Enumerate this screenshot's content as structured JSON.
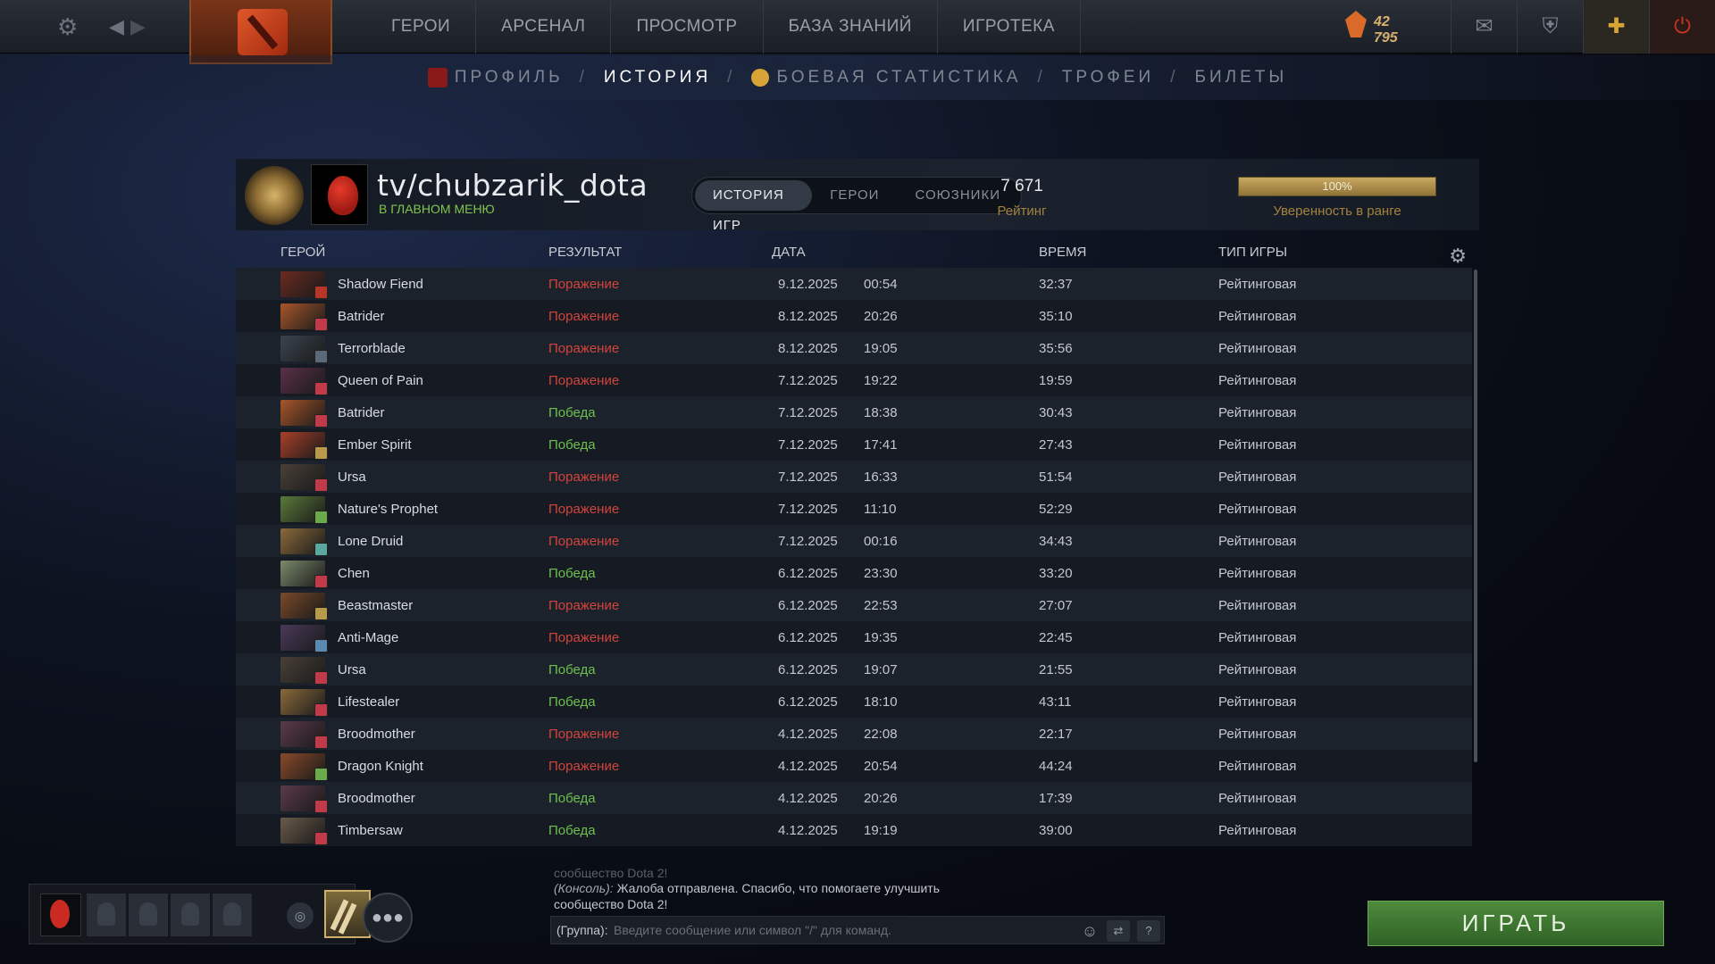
{
  "topbar": {
    "nav": [
      "ГЕРОИ",
      "АРСЕНАЛ",
      "ПРОСМОТР",
      "БАЗА ЗНАНИЙ",
      "ИГРОТЕКА"
    ],
    "currency_value": "42 795",
    "currency_sub": "○○○"
  },
  "subnav": {
    "profile": "ПРОФИЛЬ",
    "history": "ИСТОРИЯ",
    "stats": "БОЕВАЯ СТАТИСТИКА",
    "trophies": "ТРОФЕИ",
    "tickets": "БИЛЕТЫ",
    "sep": "/"
  },
  "profile": {
    "name": "tv/chubzarik_dota",
    "status": "В ГЛАВНОМ МЕНЮ",
    "tabs": [
      "ИСТОРИЯ ИГР",
      "ГЕРОИ",
      "СОЮЗНИКИ"
    ],
    "rating_value": "7 671",
    "rating_label": "Рейтинг",
    "confidence_value": "100%",
    "confidence_fraction": 1.0,
    "confidence_label": "Уверенность в ранге"
  },
  "table": {
    "headers": {
      "hero": "ГЕРОЙ",
      "result": "РЕЗУЛЬТАТ",
      "date": "ДАТА",
      "duration": "ВРЕМЯ",
      "type": "ТИП ИГРЫ"
    },
    "rows": [
      {
        "hero": "Shadow Fiend",
        "result": "Поражение",
        "win": false,
        "date": "9.12.2025",
        "time": "00:54",
        "duration": "32:37",
        "type": "Рейтинговая",
        "color": "#6b2a22",
        "badge": "#b8352a"
      },
      {
        "hero": "Batrider",
        "result": "Поражение",
        "win": false,
        "date": "8.12.2025",
        "time": "20:26",
        "duration": "35:10",
        "type": "Рейтинговая",
        "color": "#a8562a",
        "badge": "#c03a4a"
      },
      {
        "hero": "Terrorblade",
        "result": "Поражение",
        "win": false,
        "date": "8.12.2025",
        "time": "19:05",
        "duration": "35:56",
        "type": "Рейтинговая",
        "color": "#3a4450",
        "badge": "#5a6a78"
      },
      {
        "hero": "Queen of Pain",
        "result": "Поражение",
        "win": false,
        "date": "7.12.2025",
        "time": "19:22",
        "duration": "19:59",
        "type": "Рейтинговая",
        "color": "#5a3048",
        "badge": "#c03a4a"
      },
      {
        "hero": "Batrider",
        "result": "Победа",
        "win": true,
        "date": "7.12.2025",
        "time": "18:38",
        "duration": "30:43",
        "type": "Рейтинговая",
        "color": "#a8562a",
        "badge": "#c03a4a"
      },
      {
        "hero": "Ember Spirit",
        "result": "Победа",
        "win": true,
        "date": "7.12.2025",
        "time": "17:41",
        "duration": "27:43",
        "type": "Рейтинговая",
        "color": "#a8402a",
        "badge": "#b89a4a"
      },
      {
        "hero": "Ursa",
        "result": "Поражение",
        "win": false,
        "date": "7.12.2025",
        "time": "16:33",
        "duration": "51:54",
        "type": "Рейтинговая",
        "color": "#4a4038",
        "badge": "#c03a4a"
      },
      {
        "hero": "Nature's Prophet",
        "result": "Поражение",
        "win": false,
        "date": "7.12.2025",
        "time": "11:10",
        "duration": "52:29",
        "type": "Рейтинговая",
        "color": "#5a7a3a",
        "badge": "#6aaa4a"
      },
      {
        "hero": "Lone Druid",
        "result": "Поражение",
        "win": false,
        "date": "7.12.2025",
        "time": "00:16",
        "duration": "34:43",
        "type": "Рейтинговая",
        "color": "#8a6a3a",
        "badge": "#5aa8a0"
      },
      {
        "hero": "Chen",
        "result": "Победа",
        "win": true,
        "date": "6.12.2025",
        "time": "23:30",
        "duration": "33:20",
        "type": "Рейтинговая",
        "color": "#7a8a6a",
        "badge": "#c03a4a"
      },
      {
        "hero": "Beastmaster",
        "result": "Поражение",
        "win": false,
        "date": "6.12.2025",
        "time": "22:53",
        "duration": "27:07",
        "type": "Рейтинговая",
        "color": "#7a4a2a",
        "badge": "#b89a4a"
      },
      {
        "hero": "Anti-Mage",
        "result": "Поражение",
        "win": false,
        "date": "6.12.2025",
        "time": "19:35",
        "duration": "22:45",
        "type": "Рейтинговая",
        "color": "#4a3a5a",
        "badge": "#5a8ab0"
      },
      {
        "hero": "Ursa",
        "result": "Победа",
        "win": true,
        "date": "6.12.2025",
        "time": "19:07",
        "duration": "21:55",
        "type": "Рейтинговая",
        "color": "#4a4038",
        "badge": "#c03a4a"
      },
      {
        "hero": "Lifestealer",
        "result": "Победа",
        "win": true,
        "date": "6.12.2025",
        "time": "18:10",
        "duration": "43:11",
        "type": "Рейтинговая",
        "color": "#8a6a3a",
        "badge": "#c03a4a"
      },
      {
        "hero": "Broodmother",
        "result": "Поражение",
        "win": false,
        "date": "4.12.2025",
        "time": "22:08",
        "duration": "22:17",
        "type": "Рейтинговая",
        "color": "#5a3a4a",
        "badge": "#c03a4a"
      },
      {
        "hero": "Dragon Knight",
        "result": "Поражение",
        "win": false,
        "date": "4.12.2025",
        "time": "20:54",
        "duration": "44:24",
        "type": "Рейтинговая",
        "color": "#8a4a2a",
        "badge": "#6aaa4a"
      },
      {
        "hero": "Broodmother",
        "result": "Победа",
        "win": true,
        "date": "4.12.2025",
        "time": "20:26",
        "duration": "17:39",
        "type": "Рейтинговая",
        "color": "#5a3a4a",
        "badge": "#c03a4a"
      },
      {
        "hero": "Timbersaw",
        "result": "Победа",
        "win": true,
        "date": "4.12.2025",
        "time": "19:19",
        "duration": "39:00",
        "type": "Рейтинговая",
        "color": "#6a5a4a",
        "badge": "#c03a4a"
      }
    ]
  },
  "chat": {
    "faded": "сообщество Dota 2!",
    "console_tag": "(Консоль):",
    "message": "Жалоба отправлена. Спасибо, что помогаете улучшить сообщество Dota 2!",
    "prefix": "(Группа):",
    "placeholder": "Введите сообщение или символ \"/\" для команд.",
    "help": "?"
  },
  "play_label": "ИГРАТЬ",
  "colors": {
    "loss": "#d2453a",
    "win": "#6ec04e",
    "accent_gold": "#a4823e",
    "play_green": "#4e8a3c"
  }
}
